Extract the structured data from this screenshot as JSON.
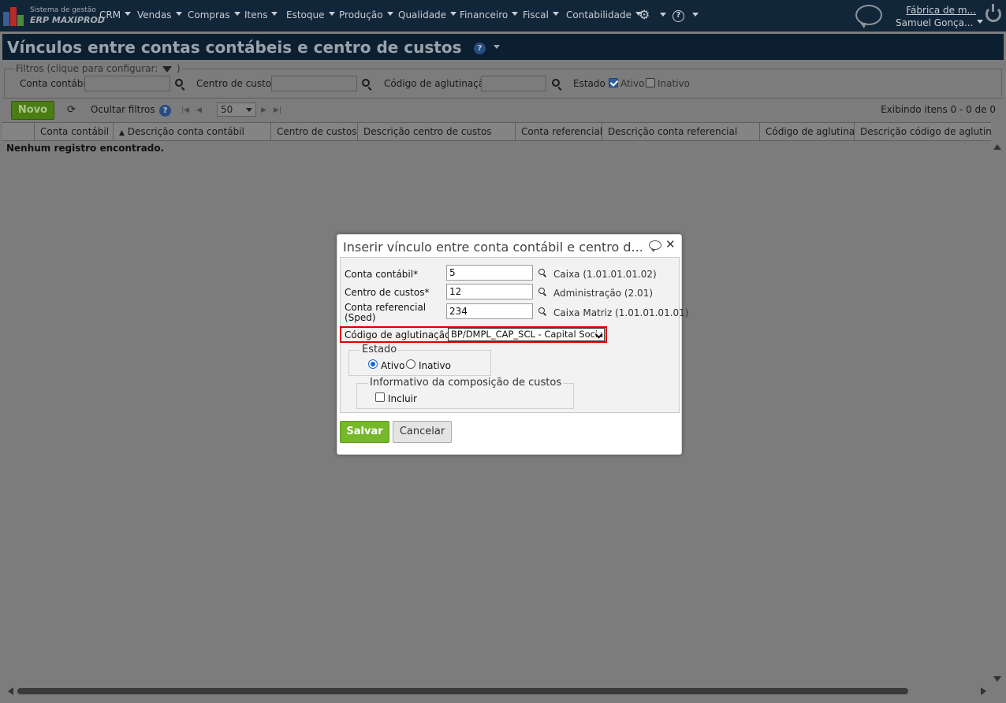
{
  "brand": {
    "line1": "Sistema de gestão",
    "line2": "ERP MAXIPROD"
  },
  "nav": {
    "items": [
      "CRM",
      "Vendas",
      "Compras",
      "Itens",
      "Estoque",
      "Produção",
      "Qualidade",
      "Financeiro",
      "Fiscal",
      "Contabilidade"
    ],
    "settings_icon": "gear-icon",
    "help_icon": "question-icon",
    "company": "Fábrica de m...",
    "user": "Samuel Gonça..."
  },
  "page": {
    "title": "Vínculos entre contas contábeis e centro de custos"
  },
  "filters": {
    "legend": "Filtros (clique para configurar:",
    "legend_end": ")",
    "conta_label": "Conta contábil",
    "centro_label": "Centro de custos",
    "codigo_label": "Código de aglutinação",
    "estado_label": "Estado",
    "ativo_label": "Ativo",
    "inativo_label": "Inativo",
    "ativo_checked": true,
    "inativo_checked": false
  },
  "toolbar": {
    "novo_label": "Novo",
    "hide_filters_label": "Ocultar filtros",
    "page_size": "50",
    "showing": "Exibindo itens 0 - 0 de 0"
  },
  "grid": {
    "columns": [
      "Conta contábil",
      "Descrição conta contábil",
      "Centro de custos",
      "Descrição centro de custos",
      "Conta referencial",
      "Descrição conta referencial",
      "Código de aglutinação",
      "Descrição código de aglutinação"
    ],
    "sort_indicator": "▲",
    "empty": "Nenhum registro encontrado."
  },
  "dialog": {
    "title": "Inserir vínculo entre conta contábil e centro d...",
    "close": "✕",
    "conta_label": "Conta contábil*",
    "conta_value": "5",
    "conta_desc": "Caixa (1.01.01.01.02)",
    "centro_label": "Centro de custos*",
    "centro_value": "12",
    "centro_desc": "Administração (2.01)",
    "ref_label_1": "Conta referencial",
    "ref_label_2": "(Sped)",
    "ref_value": "234",
    "ref_desc": "Caixa Matriz (1.01.01.01.01)",
    "codigo_label": "Código de aglutinação",
    "codigo_value": "BP/DMPL_CAP_SCL - Capital Social",
    "estado_legend": "Estado",
    "ativo_label": "Ativo",
    "inativo_label": "Inativo",
    "estado_selected": "Ativo",
    "info_legend": "Informativo da composição de custos",
    "incluir_label": "Incluir",
    "incluir_checked": false,
    "save_label": "Salvar",
    "cancel_label": "Cancelar"
  },
  "colors": {
    "nav_bg": "#12263a",
    "overlay": "#7c7c7c",
    "save_green": "#76b82a",
    "highlight_red": "#e00000",
    "checkbox_blue": "#2b5fa0"
  }
}
